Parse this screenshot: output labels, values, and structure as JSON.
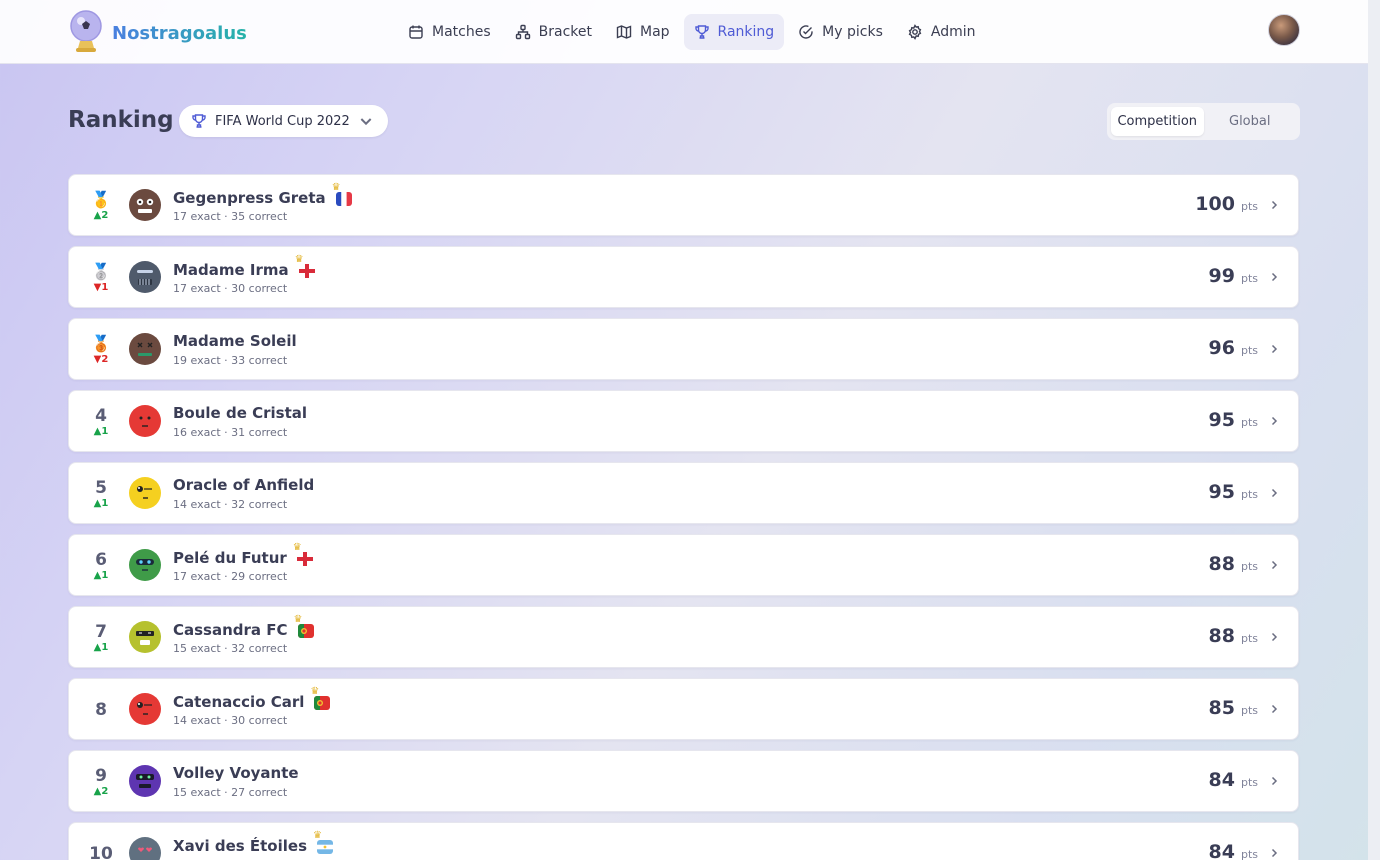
{
  "app": {
    "name": "Nostragoalus"
  },
  "nav": [
    {
      "label": "Matches",
      "icon": "calendar-icon",
      "active": false
    },
    {
      "label": "Bracket",
      "icon": "bracket-icon",
      "active": false
    },
    {
      "label": "Map",
      "icon": "map-icon",
      "active": false
    },
    {
      "label": "Ranking",
      "icon": "trophy-icon",
      "active": true
    },
    {
      "label": "My picks",
      "icon": "check-circle-icon",
      "active": false
    },
    {
      "label": "Admin",
      "icon": "gear-icon",
      "active": false
    }
  ],
  "page": {
    "title": "Ranking",
    "competition": "FIFA World Cup 2022",
    "scope_options": [
      "Competition",
      "Global"
    ],
    "scope_selected": "Competition"
  },
  "colors": {
    "accent": "#4f5bd5",
    "trend_up": "#18a34a",
    "trend_down": "#dc2626"
  },
  "ranking": [
    {
      "rank": "1",
      "medal": "🥇",
      "trend": "▲2",
      "trend_dir": "up",
      "name": "Gegenpress Greta",
      "stats": "17 exact · 35 correct",
      "points": "100",
      "unit": "pts",
      "avatar_color": "#6b4a3f",
      "pick": "france"
    },
    {
      "rank": "2",
      "medal": "🥈",
      "trend": "▼1",
      "trend_dir": "down",
      "name": "Madame Irma",
      "stats": "17 exact · 30 correct",
      "points": "99",
      "unit": "pts",
      "avatar_color": "#4f5a6b",
      "pick": "england"
    },
    {
      "rank": "3",
      "medal": "🥉",
      "trend": "▼2",
      "trend_dir": "down",
      "name": "Madame Soleil",
      "stats": "19 exact · 33 correct",
      "points": "96",
      "unit": "pts",
      "avatar_color": "#6b4a3f",
      "pick": ""
    },
    {
      "rank": "4",
      "medal": "",
      "trend": "▲1",
      "trend_dir": "up",
      "name": "Boule de Cristal",
      "stats": "16 exact · 31 correct",
      "points": "95",
      "unit": "pts",
      "avatar_color": "#e53935",
      "pick": ""
    },
    {
      "rank": "5",
      "medal": "",
      "trend": "▲1",
      "trend_dir": "up",
      "name": "Oracle of Anfield",
      "stats": "14 exact · 32 correct",
      "points": "95",
      "unit": "pts",
      "avatar_color": "#f5d020",
      "pick": ""
    },
    {
      "rank": "6",
      "medal": "",
      "trend": "▲1",
      "trend_dir": "up",
      "name": "Pelé du Futur",
      "stats": "17 exact · 29 correct",
      "points": "88",
      "unit": "pts",
      "avatar_color": "#3f9b48",
      "pick": "england"
    },
    {
      "rank": "7",
      "medal": "",
      "trend": "▲1",
      "trend_dir": "up",
      "name": "Cassandra FC",
      "stats": "15 exact · 32 correct",
      "points": "88",
      "unit": "pts",
      "avatar_color": "#b6c12e",
      "pick": "portugal"
    },
    {
      "rank": "8",
      "medal": "",
      "trend": "",
      "trend_dir": "",
      "name": "Catenaccio Carl",
      "stats": "14 exact · 30 correct",
      "points": "85",
      "unit": "pts",
      "avatar_color": "#e53935",
      "pick": "portugal"
    },
    {
      "rank": "9",
      "medal": "",
      "trend": "▲2",
      "trend_dir": "up",
      "name": "Volley Voyante",
      "stats": "15 exact · 27 correct",
      "points": "84",
      "unit": "pts",
      "avatar_color": "#5e35b1",
      "pick": ""
    },
    {
      "rank": "10",
      "medal": "",
      "trend": "",
      "trend_dir": "",
      "name": "Xavi des Étoiles",
      "stats": "",
      "points": "84",
      "unit": "pts",
      "avatar_color": "#607080",
      "pick": "argentina"
    }
  ]
}
